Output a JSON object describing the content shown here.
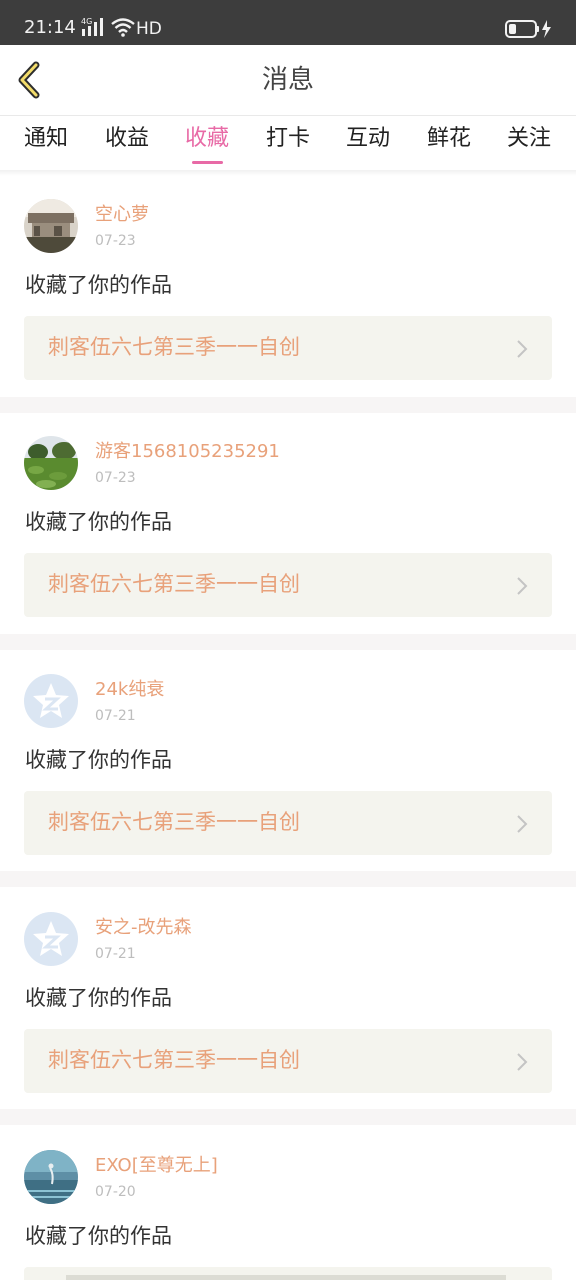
{
  "status_bar": {
    "time": "21:14",
    "network_icon": "4g-signal-icon",
    "wifi_icon": "wifi-icon",
    "hd": "HD",
    "battery_icon": "battery-charging-icon"
  },
  "header": {
    "title": "消息",
    "back_icon": "chevron-left-icon"
  },
  "tabs": [
    {
      "label": "通知"
    },
    {
      "label": "收益"
    },
    {
      "label": "收藏",
      "active": true
    },
    {
      "label": "打卡"
    },
    {
      "label": "互动"
    },
    {
      "label": "鲜花"
    },
    {
      "label": "关注"
    }
  ],
  "colors": {
    "accent": "#e86aa6",
    "username": "#e8a17a",
    "work_bg": "#f4f4ee",
    "status_bar": "#3d3d3d"
  },
  "messages": [
    {
      "username": "空心萝",
      "date": "07-23",
      "action": "收藏了你的作品",
      "work_title": "刺客伍六七第三季一一自创",
      "avatar": "photo-avatar"
    },
    {
      "username": "游客1568105235291",
      "date": "07-23",
      "action": "收藏了你的作品",
      "work_title": "刺客伍六七第三季一一自创",
      "avatar": "photo-avatar"
    },
    {
      "username": "24k纯衰",
      "date": "07-21",
      "action": "收藏了你的作品",
      "work_title": "刺客伍六七第三季一一自创",
      "avatar": "qq-default-avatar"
    },
    {
      "username": "安之-改先森",
      "date": "07-21",
      "action": "收藏了你的作品",
      "work_title": "刺客伍六七第三季一一自创",
      "avatar": "qq-default-avatar"
    },
    {
      "username": "EXO[至尊无上]",
      "date": "07-20",
      "action": "收藏了你的作品",
      "work_title": "",
      "avatar": "photo-avatar"
    }
  ]
}
